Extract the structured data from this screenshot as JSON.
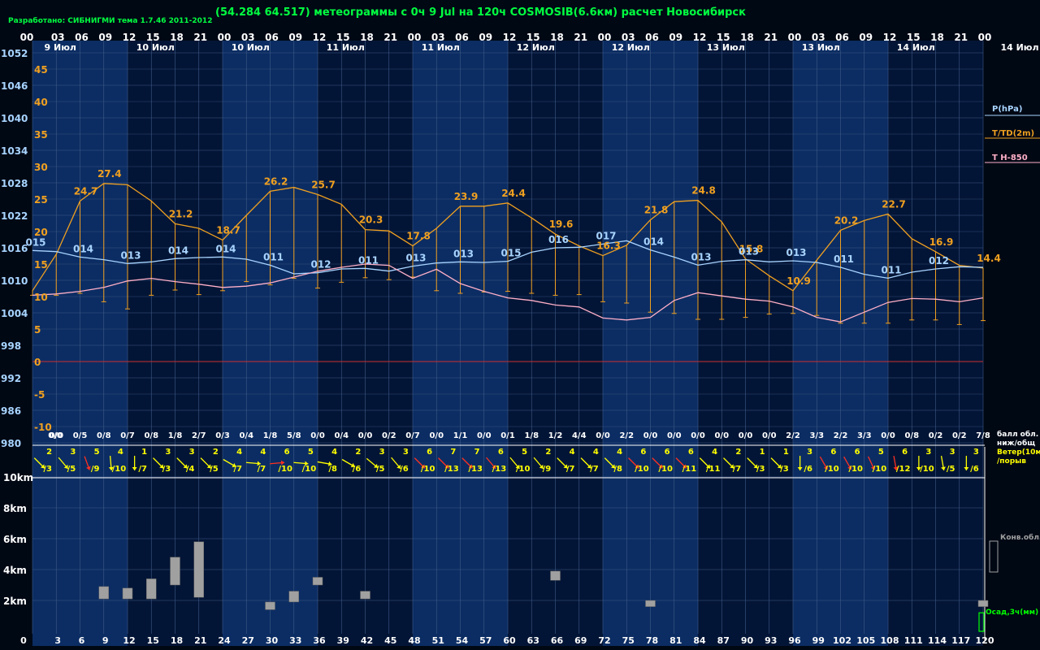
{
  "header": {
    "credit": "Разработано: СИБНИГМИ тема 1.7.46 2011-2012",
    "title": "(54.284 64.517) метеограммы с  0ч 9 Jul на 120ч COSMOSIB(6.6км) расчет Новосибирск"
  },
  "colors": {
    "pressure": "#a8d4ff",
    "temperature": "#f0a020",
    "t850": "#ffb0c8",
    "band_light": "#0c2d63",
    "band_dark": "#031536",
    "grid": "#3f5a88",
    "zero_line": "#c83030",
    "label_white": "#ffffff",
    "wind_label": "#ffff00",
    "cloud": "#a0a0a0",
    "precip": "#00ff00"
  },
  "chart_data": {
    "type": "line",
    "top_hour_ticks": [
      "00",
      "03",
      "06",
      "09",
      "12",
      "15",
      "18",
      "21",
      "00",
      "03",
      "06",
      "09",
      "12",
      "15",
      "18",
      "21",
      "00",
      "03",
      "06",
      "09",
      "12",
      "15",
      "18",
      "21",
      "00",
      "03",
      "06",
      "09",
      "12",
      "15",
      "18",
      "21",
      "00",
      "03",
      "06",
      "09",
      "12",
      "15",
      "18",
      "21",
      "00"
    ],
    "date_labels": [
      "9 Июл",
      "10 Июл",
      "10 Июл",
      "11 Июл",
      "11 Июл",
      "12 Июл",
      "12 Июл",
      "13 Июл",
      "13 Июл",
      "14 Июл",
      "14 Июл"
    ],
    "pressure_axis": [
      1052,
      1046,
      1040,
      1034,
      1028,
      1022,
      1016,
      1010,
      1004,
      998,
      992,
      986,
      980
    ],
    "temp_axis": [
      45,
      40,
      35,
      30,
      25,
      20,
      15,
      10,
      5,
      0,
      -5,
      -10
    ],
    "height_axis": [
      "10km",
      "8km",
      "6km",
      "4km",
      "2km"
    ],
    "bottom_ticks": [
      "0",
      "3",
      "6",
      "9",
      "12",
      "15",
      "18",
      "21",
      "24",
      "27",
      "30",
      "33",
      "36",
      "39",
      "42",
      "45",
      "48",
      "51",
      "54",
      "57",
      "60",
      "63",
      "66",
      "69",
      "72",
      "75",
      "78",
      "81",
      "84",
      "87",
      "90",
      "93",
      "96",
      "99",
      "102",
      "105",
      "108",
      "111",
      "114",
      "117",
      "120"
    ],
    "cloud_labels": [
      "0/0",
      "0/0",
      "0/5",
      "0/8",
      "0/7",
      "0/8",
      "1/8",
      "2/7",
      "0/3",
      "0/4",
      "1/8",
      "5/8",
      "0/0",
      "0/4",
      "0/0",
      "0/2",
      "0/7",
      "0/0",
      "1/1",
      "0/0",
      "0/1",
      "1/8",
      "1/2",
      "4/4",
      "0/0",
      "2/2",
      "0/0",
      "0/0",
      "0/0",
      "0/0",
      "0/0",
      "0/0",
      "2/2",
      "3/3",
      "2/2",
      "3/3",
      "0/0",
      "0/8",
      "0/2",
      "0/2",
      "7/8"
    ],
    "wind_speed": [
      "2",
      "3",
      "5",
      "4",
      "1",
      "3",
      "3",
      "2",
      "4",
      "4",
      "6",
      "5",
      "4",
      "2",
      "3",
      "3",
      "6",
      "7",
      "7",
      "6",
      "5",
      "2",
      "4",
      "4",
      "4",
      "6",
      "6",
      "6",
      "4",
      "2",
      "1",
      "1",
      "3",
      "6",
      "6",
      "5",
      "6",
      "3",
      "3",
      "3"
    ],
    "wind_gust": [
      "/3",
      "/5",
      "/9",
      "/10",
      "/7",
      "/3",
      "/4",
      "/5",
      "/7",
      "/7",
      "/10",
      "/10",
      "/8",
      "/6",
      "/5",
      "/6",
      "/10",
      "/13",
      "/13",
      "/13",
      "/10",
      "/9",
      "/7",
      "/7",
      "/8",
      "/10",
      "/10",
      "/11",
      "/11",
      "/7",
      "/3",
      "/3",
      "/6",
      "/10",
      "/10",
      "/10",
      "/12",
      "/10",
      "/5",
      "/6"
    ],
    "wind_colors": [
      "y",
      "y",
      "r",
      "y",
      "y",
      "y",
      "y",
      "y",
      "y",
      "y",
      "r",
      "y",
      "y",
      "y",
      "y",
      "y",
      "r",
      "r",
      "r",
      "r",
      "y",
      "y",
      "y",
      "y",
      "y",
      "r",
      "r",
      "r",
      "y",
      "y",
      "y",
      "y",
      "y",
      "r",
      "r",
      "r",
      "r",
      "y",
      "y",
      "y"
    ],
    "wind_angles": [
      45,
      40,
      20,
      5,
      0,
      45,
      45,
      45,
      60,
      85,
      95,
      85,
      80,
      60,
      50,
      40,
      45,
      45,
      45,
      40,
      40,
      40,
      45,
      45,
      45,
      45,
      45,
      45,
      45,
      45,
      45,
      45,
      0,
      30,
      30,
      25,
      10,
      0,
      10,
      0
    ],
    "series": [
      {
        "name": "P(hPa)",
        "values": [
          1015.5,
          1015.3,
          1014.3,
          1013.8,
          1013.1,
          1013.4,
          1014.0,
          1014.2,
          1014.3,
          1013.9,
          1012.8,
          1011.2,
          1011.4,
          1012.1,
          1012.2,
          1011.7,
          1012.6,
          1013.2,
          1013.4,
          1013.3,
          1013.5,
          1015.2,
          1016.0,
          1016.1,
          1016.7,
          1017.3,
          1015.6,
          1014.3,
          1012.8,
          1013.5,
          1013.8,
          1013.4,
          1013.6,
          1013.3,
          1012.4,
          1011.1,
          1010.4,
          1011.5,
          1012.1,
          1012.5,
          1012.4
        ],
        "labels": [
          "015",
          "",
          "014",
          "",
          "013",
          "",
          "014",
          "",
          "014",
          "",
          "011",
          "",
          "012",
          "",
          "011",
          "",
          "013",
          "",
          "013",
          "",
          "015",
          "",
          "016",
          "",
          "017",
          "",
          "014",
          "",
          "013",
          "",
          "013",
          "",
          "013",
          "",
          "011",
          "",
          "011",
          "",
          "012",
          ""
        ]
      },
      {
        "name": "T/TD(2m)",
        "values": [
          10.9,
          16.5,
          24.7,
          27.4,
          27.2,
          24.7,
          21.2,
          20.5,
          18.7,
          22.5,
          26.2,
          26.8,
          25.7,
          24.2,
          20.3,
          20.1,
          17.8,
          20.5,
          23.9,
          23.9,
          24.4,
          22.1,
          19.6,
          17.8,
          16.3,
          17.9,
          21.8,
          24.6,
          24.8,
          21.5,
          15.8,
          13.2,
          10.9,
          15.6,
          20.2,
          21.7,
          22.7,
          18.9,
          16.9,
          14.8,
          14.4
        ],
        "labels": [
          "",
          "",
          "24.7",
          "27.4",
          "",
          "",
          "21.2",
          "",
          "18.7",
          "",
          "26.2",
          "",
          "25.7",
          "",
          "20.3",
          "",
          "17.8",
          "",
          "23.9",
          "",
          "24.4",
          "",
          "19.6",
          "",
          "16.3",
          "",
          "21.8",
          "",
          "24.8",
          "",
          "15.8",
          "",
          "10.9",
          "",
          "20.2",
          "",
          "22.7",
          "",
          "16.9",
          "",
          "14.4"
        ],
        "td_values": [
          10.2,
          10.2,
          10.5,
          9.2,
          8.1,
          10.2,
          11.0,
          10.3,
          10.9,
          12.3,
          11.8,
          12.8,
          11.3,
          12.2,
          12.9,
          12.6,
          13.0,
          10.9,
          10.5,
          10.7,
          10.8,
          10.5,
          10.2,
          10.3,
          9.2,
          9.0,
          7.6,
          7.4,
          6.5,
          6.5,
          6.8,
          7.3,
          7.4,
          7.1,
          5.9,
          5.9,
          5.9,
          6.4,
          6.4,
          5.7,
          6.3
        ]
      },
      {
        "name": "T H-850",
        "values": [
          10.2,
          10.4,
          10.8,
          11.4,
          12.4,
          12.8,
          12.3,
          11.9,
          11.4,
          11.6,
          12.1,
          13.0,
          13.9,
          14.5,
          15.0,
          14.8,
          12.8,
          14.2,
          12.0,
          10.8,
          9.8,
          9.4,
          8.7,
          8.4,
          6.7,
          6.4,
          6.8,
          9.4,
          10.6,
          10.1,
          9.6,
          9.3,
          8.4,
          6.8,
          6.1,
          7.6,
          9.1,
          9.7,
          9.6,
          9.2,
          9.8
        ]
      }
    ],
    "convective_clouds": [
      {
        "x": 9,
        "bottom_km": 2.1,
        "top_km": 2.9
      },
      {
        "x": 12,
        "bottom_km": 2.1,
        "top_km": 2.8
      },
      {
        "x": 15,
        "bottom_km": 2.1,
        "top_km": 3.4
      },
      {
        "x": 18,
        "bottom_km": 3.0,
        "top_km": 4.8
      },
      {
        "x": 21,
        "bottom_km": 2.2,
        "top_km": 5.8
      },
      {
        "x": 30,
        "bottom_km": 1.4,
        "top_km": 1.9
      },
      {
        "x": 33,
        "bottom_km": 1.9,
        "top_km": 2.6
      },
      {
        "x": 36,
        "bottom_km": 3.0,
        "top_km": 3.5
      },
      {
        "x": 42,
        "bottom_km": 2.1,
        "top_km": 2.6
      },
      {
        "x": 66,
        "bottom_km": 3.3,
        "top_km": 3.9
      },
      {
        "x": 78,
        "bottom_km": 1.6,
        "top_km": 2.0
      },
      {
        "x": 120,
        "bottom_km": 1.6,
        "top_km": 2.0
      }
    ],
    "precip_3h": [
      {
        "x": 120,
        "value_mm": 1
      }
    ]
  },
  "legend": {
    "pressure": "P(hPa)",
    "temperature": "T/TD(2m)",
    "t850": "T H-850",
    "cloud_cover": [
      "балл обл.",
      "ниж/общ"
    ],
    "wind": [
      "Ветер(10м)",
      "/порыв"
    ],
    "conv": "Конв.обл.",
    "precip": "Осад,3ч(мм)"
  }
}
